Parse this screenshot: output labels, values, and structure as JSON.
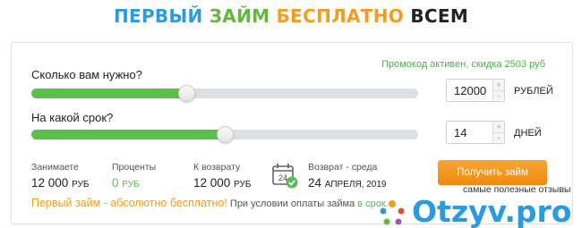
{
  "headline": {
    "part1": "ПЕРВЫЙ",
    "part2": "ЗАЙМ",
    "part3": "БЕСПЛАТНО",
    "part4": "ВСЕМ"
  },
  "colors": {
    "blue": "#2a9be0",
    "green": "#66b53e",
    "orange": "#f39c1f",
    "slider_fill": "#5bc14a",
    "slider_track": "#dde0e3",
    "button": "#f39c1f"
  },
  "promo_text": "Промокод активен, скидка 2503 руб",
  "amount": {
    "label": "Сколько вам нужно?",
    "value": "12000",
    "unit": "РУБЛЕЙ",
    "slider_level": 0.4
  },
  "term": {
    "label": "На какой срок?",
    "value": "14",
    "unit": "ДНЕЙ",
    "slider_level": 0.5
  },
  "stepper": {
    "plus": "+",
    "minus": "-"
  },
  "summary": {
    "borrow_label": "Занимаете",
    "borrow_value": "12 000",
    "borrow_currency": "РУБ",
    "interest_label": "Проценты",
    "interest_value": "0",
    "interest_currency": "РУБ",
    "return_label": "К возврату",
    "return_value": "12 000",
    "return_currency": "РУБ",
    "calendar_day": "24",
    "due_label": "Возврат - среда",
    "due_day": "24",
    "due_rest": "АПРЕЛЯ, 2019"
  },
  "cta_label": "Получить займ",
  "footer": {
    "free": "Первый займ - абсолютно бесплатно!",
    "condition": "При условии оплаты займа",
    "condition_link": "в срок."
  },
  "watermark": {
    "caption": "самые полезные отзывы",
    "brand": "Otzyv.pro"
  },
  "icons": {
    "calendar": "calendar-check-icon",
    "logo": "otzyv-logo-icon"
  }
}
